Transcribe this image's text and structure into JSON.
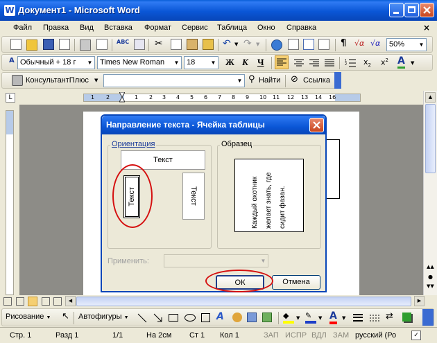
{
  "window": {
    "title": "Документ1 - Microsoft Word"
  },
  "menu": [
    "Файл",
    "Правка",
    "Вид",
    "Вставка",
    "Формат",
    "Сервис",
    "Таблица",
    "Окно",
    "Справка"
  ],
  "toolbar": {
    "zoom": "50%"
  },
  "formatting": {
    "style": "Обычный + 18 г",
    "font": "Times New Roman",
    "size": "18",
    "bold": "Ж",
    "italic": "К",
    "underline": "Ч"
  },
  "consultant": {
    "label": "КонсультантПлюс",
    "find": "Найти",
    "link": "Ссылка"
  },
  "ruler": {
    "ticks": [
      "1",
      "2",
      "1",
      "2",
      "3",
      "4",
      "5",
      "6",
      "7",
      "8",
      "9",
      "10",
      "11",
      "12",
      "13",
      "14",
      "16"
    ]
  },
  "dialog": {
    "title": "Направление текста - Ячейка таблицы",
    "orientation_label": "Ориентация",
    "sample_label": "Образец",
    "options": [
      "Текст",
      "Текст",
      "Текст"
    ],
    "sample_text": "Каждый охотник желает знать, где сидит фазан.",
    "apply_label": "Применить:",
    "ok": "ОК",
    "cancel": "Отмена"
  },
  "drawing": {
    "draw": "Рисование",
    "autoshapes": "Автофигуры"
  },
  "status": {
    "page": "Стр. 1",
    "section": "Разд 1",
    "pages": "1/1",
    "at": "На 2см",
    "line": "Ст 1",
    "col": "Кол 1",
    "rec": "ЗАП",
    "trk": "ИСПР",
    "ext": "ВДЛ",
    "ovr": "ЗАМ",
    "lang": "русский (Ро"
  },
  "colors": {
    "title_blue": "#0a56d6",
    "annotation_red": "#d51010",
    "highlight_yellow": "#ffff00",
    "font_color_red": "#ff0000"
  }
}
